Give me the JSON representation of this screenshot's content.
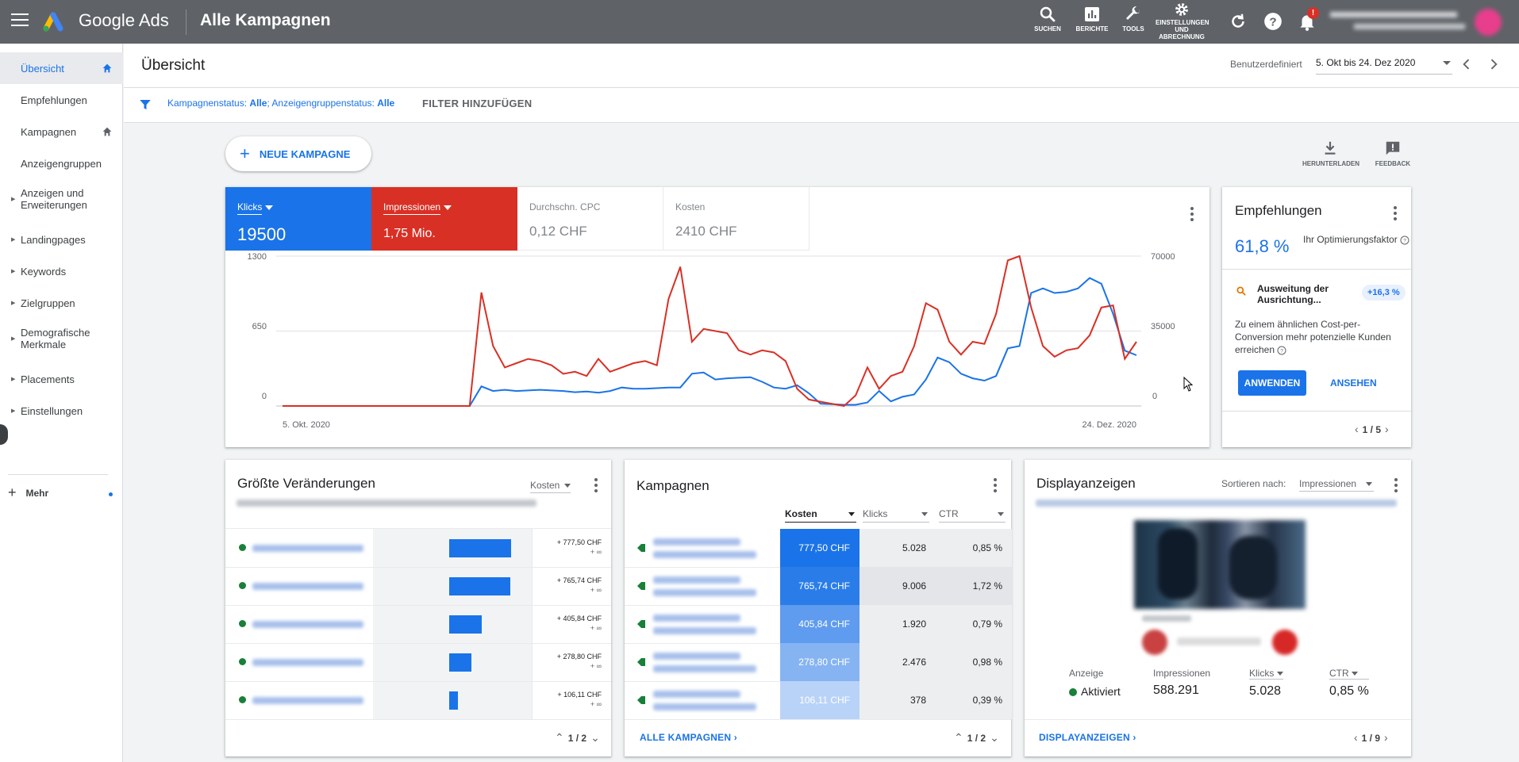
{
  "topbar": {
    "brand": "Google Ads",
    "title": "Alle Kampagnen",
    "tools": [
      {
        "label": "SUCHEN",
        "icon": "search-icon"
      },
      {
        "label": "BERICHTE",
        "icon": "reports-icon"
      },
      {
        "label": "TOOLS",
        "icon": "wrench-icon"
      },
      {
        "label": "EINSTELLUNGEN UND ABRECHNUNG",
        "icon": "gear-icon"
      }
    ],
    "notification_badge": "!"
  },
  "sidebar": {
    "items": [
      {
        "label": "Übersicht"
      },
      {
        "label": "Empfehlungen"
      },
      {
        "label": "Kampagnen"
      },
      {
        "label": "Anzeigengruppen"
      },
      {
        "label": "Anzeigen und Erweiterungen"
      },
      {
        "label": "Landingpages"
      },
      {
        "label": "Keywords"
      },
      {
        "label": "Zielgruppen"
      },
      {
        "label": "Demografische Merkmale"
      },
      {
        "label": "Placements"
      },
      {
        "label": "Einstellungen"
      }
    ],
    "more": "Mehr"
  },
  "page": {
    "title": "Übersicht",
    "date_label": "Benutzerdefiniert",
    "date_range": "5. Okt bis 24. Dez 2020"
  },
  "filter": {
    "prefix1": "Kampagnenstatus: ",
    "val1": "Alle",
    "prefix2": "; Anzeigengruppenstatus: ",
    "val2": "Alle",
    "add": "FILTER HINZUFÜGEN"
  },
  "actions": {
    "new_campaign": "NEUE KAMPAGNE",
    "download": "HERUNTERLADEN",
    "feedback": "FEEDBACK"
  },
  "metrics": [
    {
      "label": "Klicks",
      "value": "19500",
      "color": "#1a73e8"
    },
    {
      "label": "Impressionen",
      "value": "1,75 Mio.",
      "color": "#d93025"
    },
    {
      "label": "Durchschn. CPC",
      "value": "0,12 CHF"
    },
    {
      "label": "Kosten",
      "value": "2410 CHF"
    }
  ],
  "chart_data": {
    "type": "line",
    "x_start_label": "5. Okt. 2020",
    "x_end_label": "24. Dez. 2020",
    "y_left_ticks": [
      "1300",
      "650",
      "0"
    ],
    "y_right_ticks": [
      "70000",
      "35000",
      "0"
    ],
    "y_left_range": [
      0,
      1300
    ],
    "y_right_range": [
      0,
      70000
    ],
    "grid": true,
    "series": [
      {
        "name": "Klicks",
        "axis": "left",
        "color": "#1a73e8",
        "values": [
          0,
          0,
          0,
          0,
          0,
          0,
          0,
          0,
          0,
          0,
          0,
          0,
          0,
          0,
          0,
          0,
          0,
          170,
          130,
          140,
          130,
          135,
          140,
          135,
          130,
          120,
          125,
          115,
          130,
          160,
          150,
          150,
          155,
          160,
          160,
          280,
          290,
          230,
          240,
          245,
          250,
          210,
          160,
          150,
          180,
          110,
          20,
          15,
          10,
          10,
          30,
          130,
          40,
          80,
          100,
          230,
          420,
          380,
          280,
          240,
          220,
          260,
          500,
          520,
          980,
          1020,
          980,
          990,
          1020,
          1110,
          1060,
          800,
          480,
          440
        ]
      },
      {
        "name": "Impressionen",
        "axis": "right",
        "color": "#d93025",
        "values": [
          0,
          0,
          0,
          0,
          0,
          0,
          0,
          0,
          0,
          0,
          0,
          0,
          0,
          0,
          0,
          0,
          0,
          53000,
          28000,
          18000,
          20000,
          22000,
          21000,
          19000,
          15000,
          16000,
          14000,
          22000,
          16000,
          18000,
          20000,
          21000,
          19000,
          50000,
          65000,
          30000,
          36000,
          35000,
          34000,
          26000,
          24000,
          26000,
          25000,
          21000,
          8000,
          3000,
          2000,
          1000,
          0,
          5000,
          18000,
          8000,
          14000,
          16000,
          28000,
          48000,
          45000,
          30000,
          24000,
          30000,
          29000,
          43000,
          68000,
          70000,
          46000,
          28000,
          23000,
          26000,
          27000,
          33000,
          46000,
          47000,
          22000,
          30000
        ]
      }
    ]
  },
  "recommendations": {
    "title": "Empfehlungen",
    "score": "61,8 %",
    "score_label": "Ihr Optimierungsfaktor",
    "item_title": "Ausweitung der Ausrichtung...",
    "item_badge": "+16,3 %",
    "item_desc": "Zu einem ähnlichen Cost-per-Conversion mehr potenzielle Kunden erreichen",
    "apply": "ANWENDEN",
    "view": "ANSEHEN",
    "pager": "1 / 5"
  },
  "changes": {
    "title": "Größte Veränderungen",
    "sort": "Kosten",
    "values": [
      0.777,
      0.766,
      0.406,
      0.279,
      0.106
    ],
    "rows": [
      {
        "value": "+ 777,50 CHF",
        "delta": "+ ∞"
      },
      {
        "value": "+ 765,74 CHF",
        "delta": "+ ∞"
      },
      {
        "value": "+ 405,84 CHF",
        "delta": "+ ∞"
      },
      {
        "value": "+ 278,80 CHF",
        "delta": "+ ∞"
      },
      {
        "value": "+ 106,11 CHF",
        "delta": "+ ∞"
      }
    ],
    "pager": "1 / 2"
  },
  "campaigns": {
    "title": "Kampagnen",
    "headers": [
      "Kosten",
      "Klicks",
      "CTR"
    ],
    "rows": [
      {
        "cost": "777,50 CHF",
        "clicks": "5.028",
        "ctr": "0,85 %",
        "shade": "#1a73e8"
      },
      {
        "cost": "765,74 CHF",
        "clicks": "9.006",
        "ctr": "1,72 %",
        "shade": "#2a7de9"
      },
      {
        "cost": "405,84 CHF",
        "clicks": "1.920",
        "ctr": "0,79 %",
        "shade": "#5f9bee"
      },
      {
        "cost": "278,80 CHF",
        "clicks": "2.476",
        "ctr": "0,98 %",
        "shade": "#86b4f2"
      },
      {
        "cost": "106,11 CHF",
        "clicks": "378",
        "ctr": "0,39 %",
        "shade": "#b9d3f8"
      }
    ],
    "all_link": "ALLE KAMPAGNEN",
    "pager": "1 / 2"
  },
  "display": {
    "title": "Displayanzeigen",
    "sort_label": "Sortieren nach:",
    "sort_value": "Impressionen",
    "stat_labels": [
      "Anzeige",
      "Impressionen",
      "Klicks",
      "CTR"
    ],
    "status": "Aktiviert",
    "impressions": "588.291",
    "clicks": "5.028",
    "ctr": "0,85 %",
    "link": "DISPLAYANZEIGEN",
    "pager": "1 / 9"
  }
}
